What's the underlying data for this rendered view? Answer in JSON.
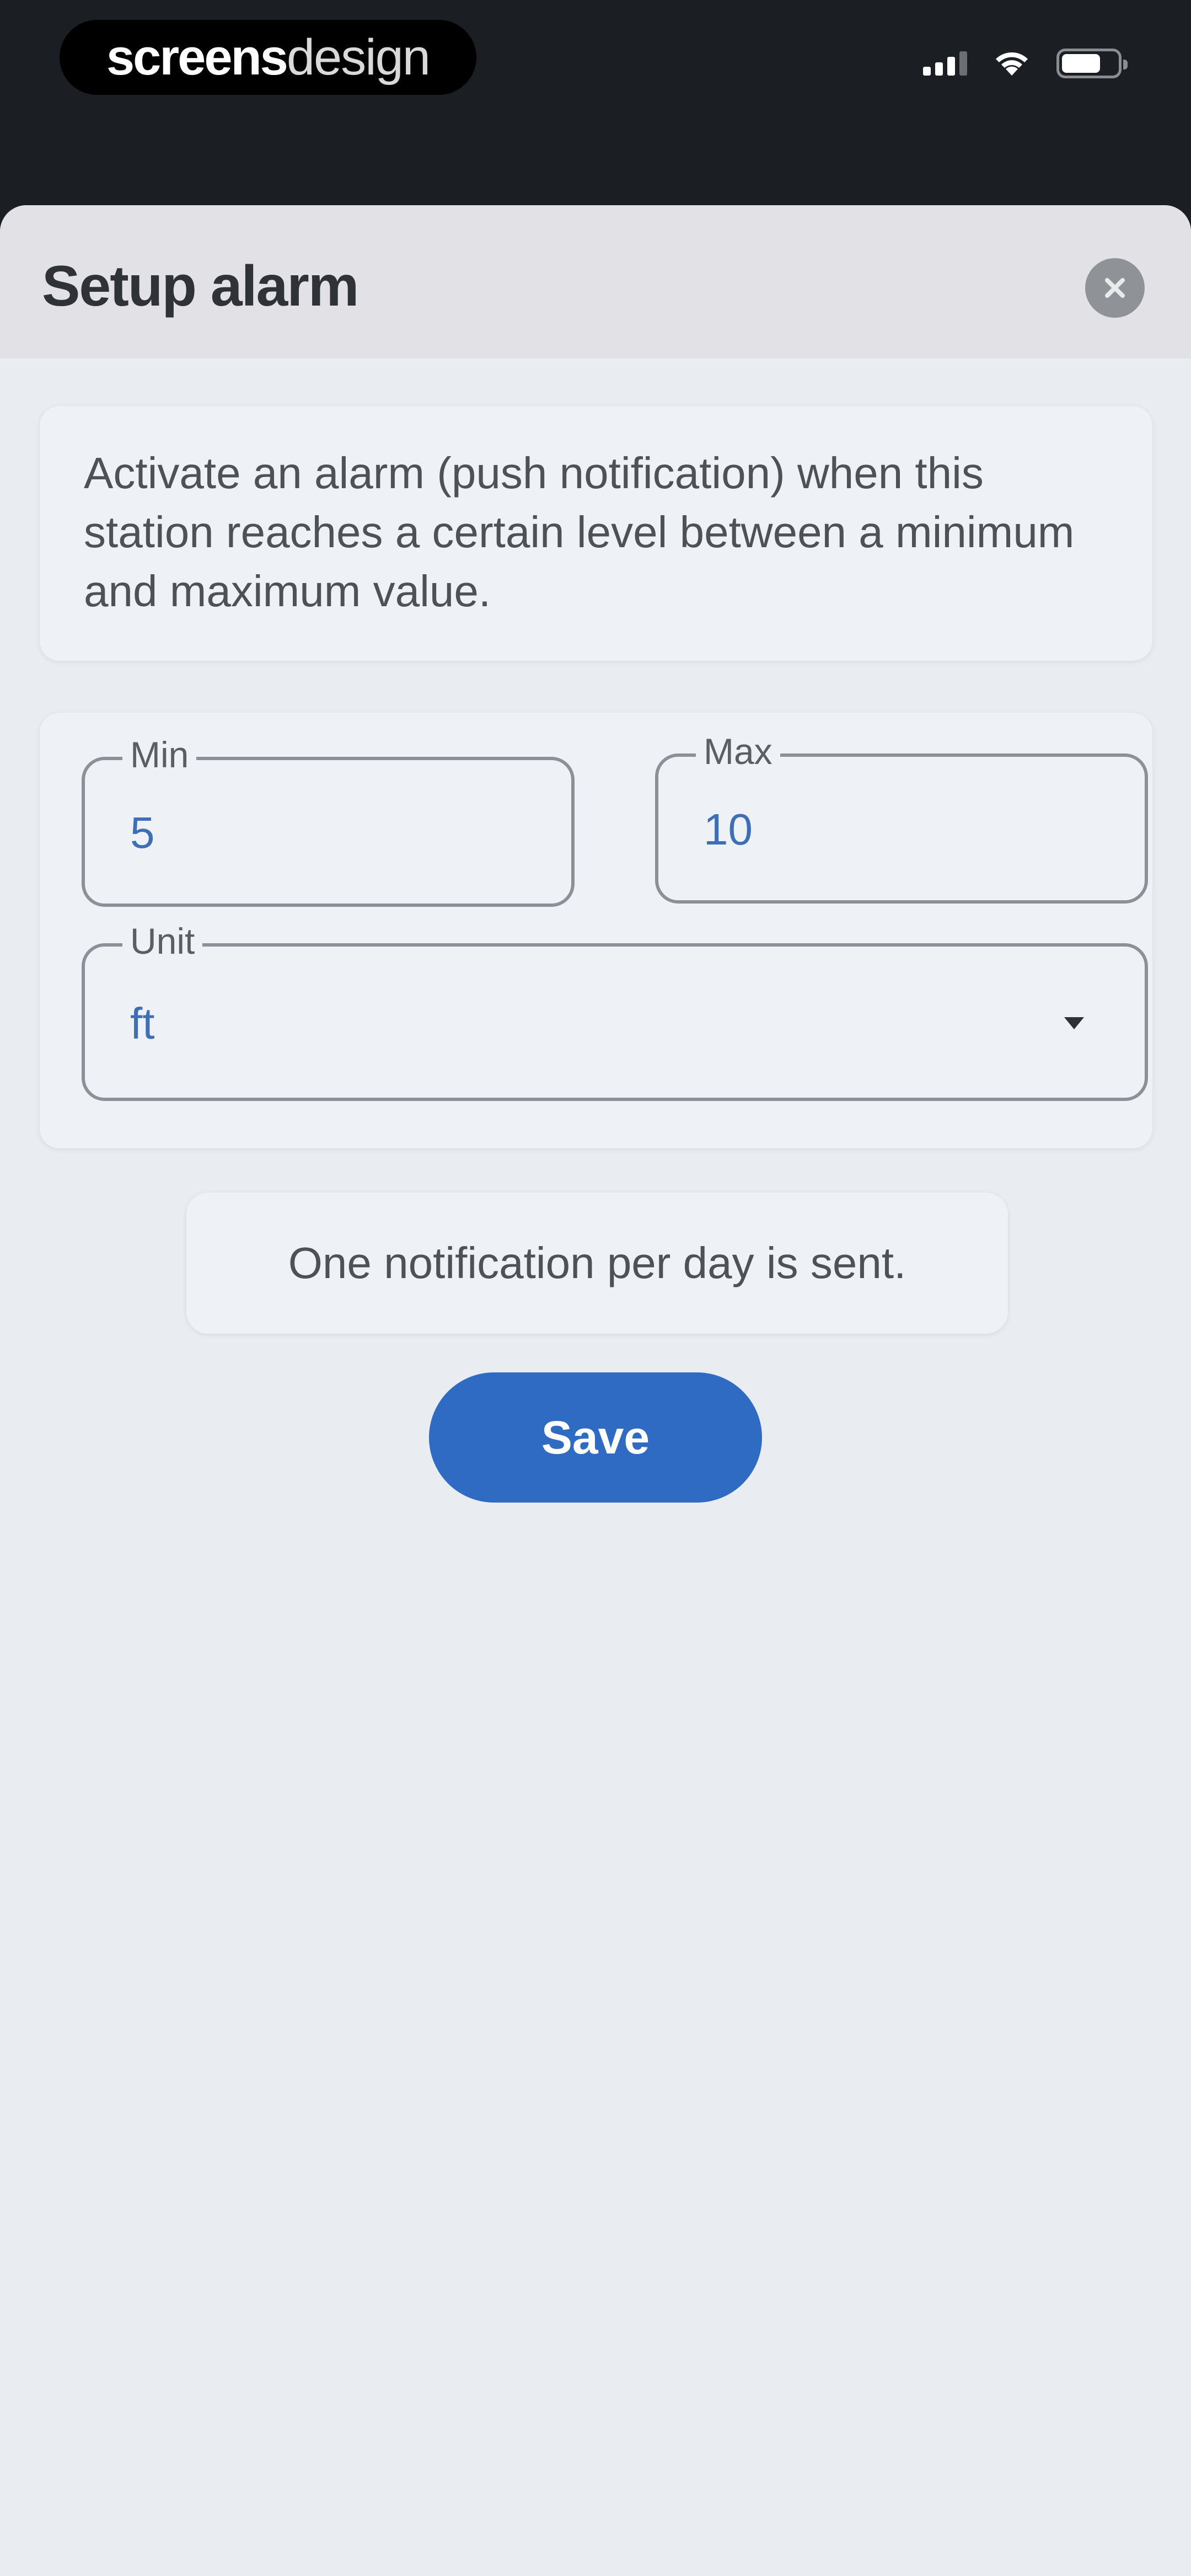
{
  "status_bar": {
    "brand_strong": "screens",
    "brand_light": "design"
  },
  "modal": {
    "title": "Setup alarm",
    "description": "Activate an alarm (push notification) when this station reaches a certain level between a minimum and maximum value.",
    "min_label": "Min",
    "min_value": "5",
    "max_label": "Max",
    "max_value": "10",
    "unit_label": "Unit",
    "unit_value": "ft",
    "note": "One notification per day is sent.",
    "save_label": "Save"
  },
  "colors": {
    "accent": "#2f6bc3",
    "value_text": "#3e6eb5",
    "sheet_background": "#e9edf1",
    "header_background": "#e2e2e6"
  }
}
